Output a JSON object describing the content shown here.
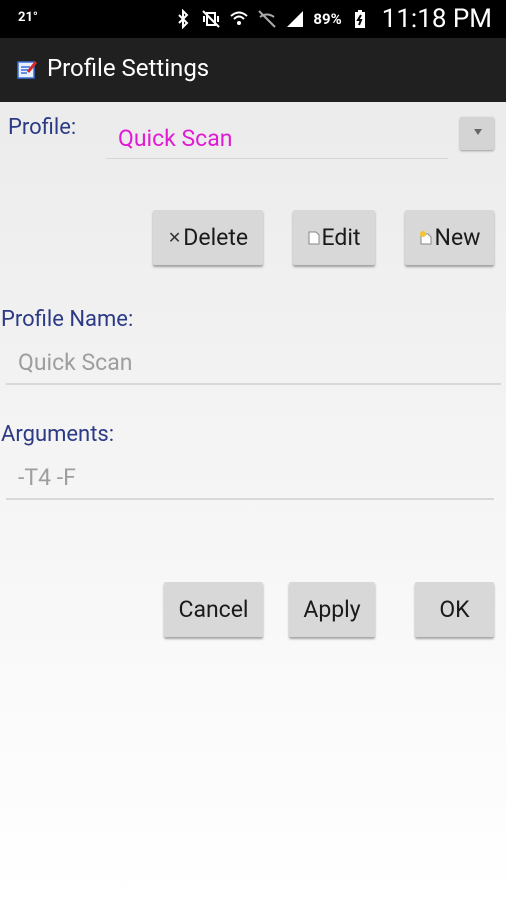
{
  "status_bar": {
    "temperature": "21°",
    "battery": "89%",
    "time": "11:18 PM",
    "icons": [
      "bluetooth-icon",
      "vibrate-icon",
      "wifi-icon",
      "data-icon",
      "signal-icon",
      "battery-charging-icon"
    ]
  },
  "app_bar": {
    "title": "Profile Settings",
    "icon": "notepad-icon"
  },
  "profile": {
    "label": "Profile:",
    "selected": "Quick Scan",
    "selected_color": "#e11bd5"
  },
  "actions": {
    "delete_label": "Delete",
    "edit_label": "Edit",
    "new_label": "New"
  },
  "form": {
    "name_label": "Profile Name:",
    "name_value": "Quick Scan",
    "arguments_label": "Arguments:",
    "arguments_value": "-T4 -F"
  },
  "footer": {
    "cancel_label": "Cancel",
    "apply_label": "Apply",
    "ok_label": "OK"
  },
  "colors": {
    "label": "#2c3a85",
    "app_bar": "#202020",
    "button": "#d8d8d8"
  }
}
